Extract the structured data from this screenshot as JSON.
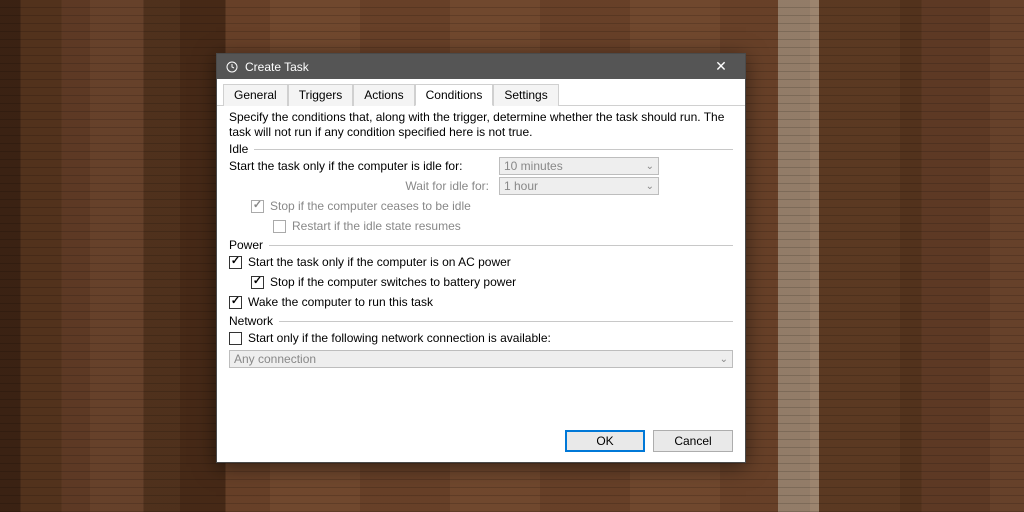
{
  "titlebar": {
    "title": "Create Task"
  },
  "tabs": {
    "general": "General",
    "triggers": "Triggers",
    "actions": "Actions",
    "conditions": "Conditions",
    "settings": "Settings"
  },
  "description": "Specify the conditions that, along with the trigger, determine whether the task should run.  The task will not run  if any condition specified here is not true.",
  "groups": {
    "idle": {
      "label": "Idle",
      "start_only_idle": "Start the task only if the computer is idle for:",
      "idle_duration": "10 minutes",
      "wait_for_idle": "Wait for idle for:",
      "wait_duration": "1 hour",
      "stop_if_ceases": "Stop if the computer ceases to be idle",
      "restart_if_resumes": "Restart if the idle state resumes"
    },
    "power": {
      "label": "Power",
      "on_ac": "Start the task only if the computer is on AC power",
      "stop_on_battery": "Stop if the computer switches to battery power",
      "wake_to_run": "Wake the computer to run this task"
    },
    "network": {
      "label": "Network",
      "start_only_network": "Start only if the following network connection is available:",
      "connection": "Any connection"
    }
  },
  "buttons": {
    "ok": "OK",
    "cancel": "Cancel"
  }
}
